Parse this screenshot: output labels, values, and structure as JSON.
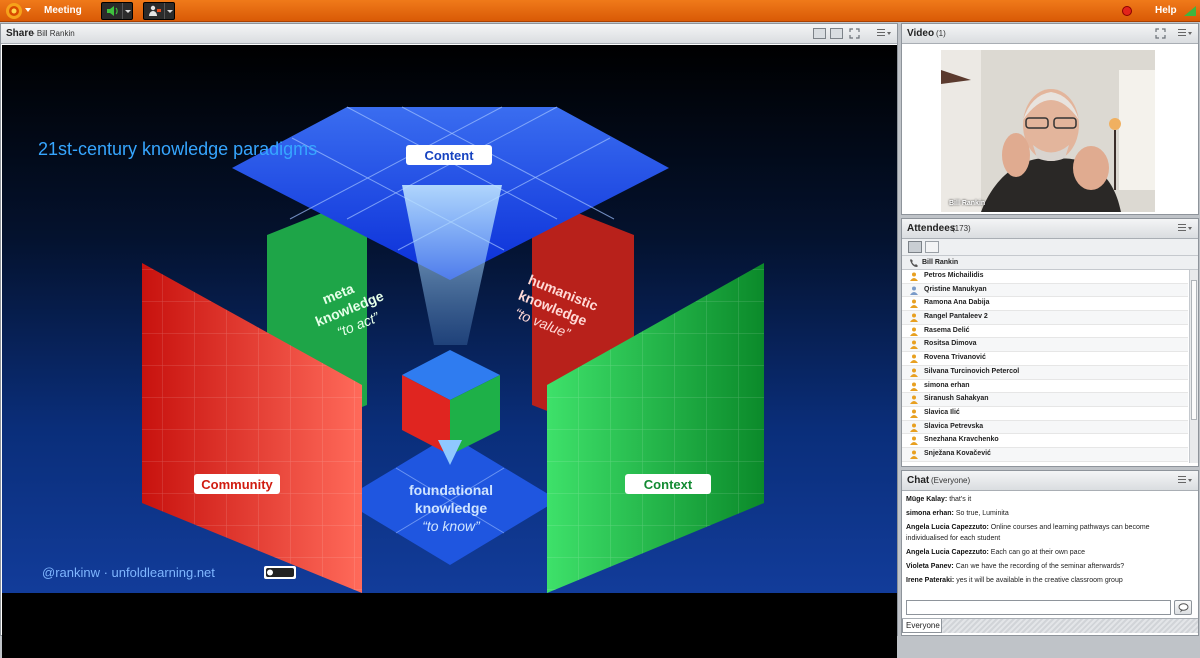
{
  "topbar": {
    "menu_meeting": "Meeting",
    "help": "Help",
    "colors": {
      "bar": "#e26810",
      "status": "#e3241b"
    },
    "icons": [
      "adobe-connect-logo",
      "speaker-icon",
      "webcam-presenter-icon",
      "status-dot",
      "signal-bars-icon"
    ]
  },
  "share": {
    "title": "Share",
    "subtitle": "- Bill Rankin"
  },
  "slide": {
    "heading": "21st-century knowledge paradigms",
    "content_label": "Content",
    "community_label": "Community",
    "context_label": "Context",
    "meta_line1": "meta",
    "meta_line2": "knowledge",
    "meta_line3": "“to act”",
    "humanistic_line1": "humanistic",
    "humanistic_line2": "knowledge",
    "humanistic_line3": "“to value”",
    "foundational_line1": "foundational",
    "foundational_line2": "knowledge",
    "foundational_line3": "“to know”",
    "footer": "@rankinw  ·  unfoldlearning.net",
    "license_badge": "cc-by-nc-icon"
  },
  "video": {
    "title": "Video",
    "count": "(1)",
    "speaker_name": "Bill Rankin"
  },
  "attendees": {
    "title": "Attendees",
    "count": "(173)",
    "host": "Bill Rankin",
    "list": [
      "Petros Michailidis",
      "Qristine Manukyan",
      "Ramona Ana Dabija",
      "Rangel Pantaleev 2",
      "Rasema Delić",
      "Rositsa Dimova",
      "Rovena  Trivanović",
      "Silvana Turcinovich Petercol",
      "simona erhan",
      "Siranush Sahakyan",
      "Slavica Ilić",
      "Slavica Petrevska",
      "Snezhana Kravchenko",
      "Snježana Kovačević"
    ]
  },
  "chat": {
    "title": "Chat",
    "scope": "(Everyone)",
    "messages": [
      {
        "sender": "Müge Kalay:",
        "text": "that's it"
      },
      {
        "sender": "simona erhan:",
        "text": "So true, Luminita"
      },
      {
        "sender": "Angela Lucia  Capezzuto:",
        "text": "Online courses and learning pathways can become individualised for each student"
      },
      {
        "sender": "Angela Lucia  Capezzuto:",
        "text": "Each can go at their own pace"
      },
      {
        "sender": "Violeta Panev:",
        "text": "Can we have the recording of the seminar afterwards?"
      },
      {
        "sender": "Irene Pateraki:",
        "text": "yes it will be available in the creative classroom group"
      }
    ],
    "input_placeholder": "",
    "tab": "Everyone"
  }
}
